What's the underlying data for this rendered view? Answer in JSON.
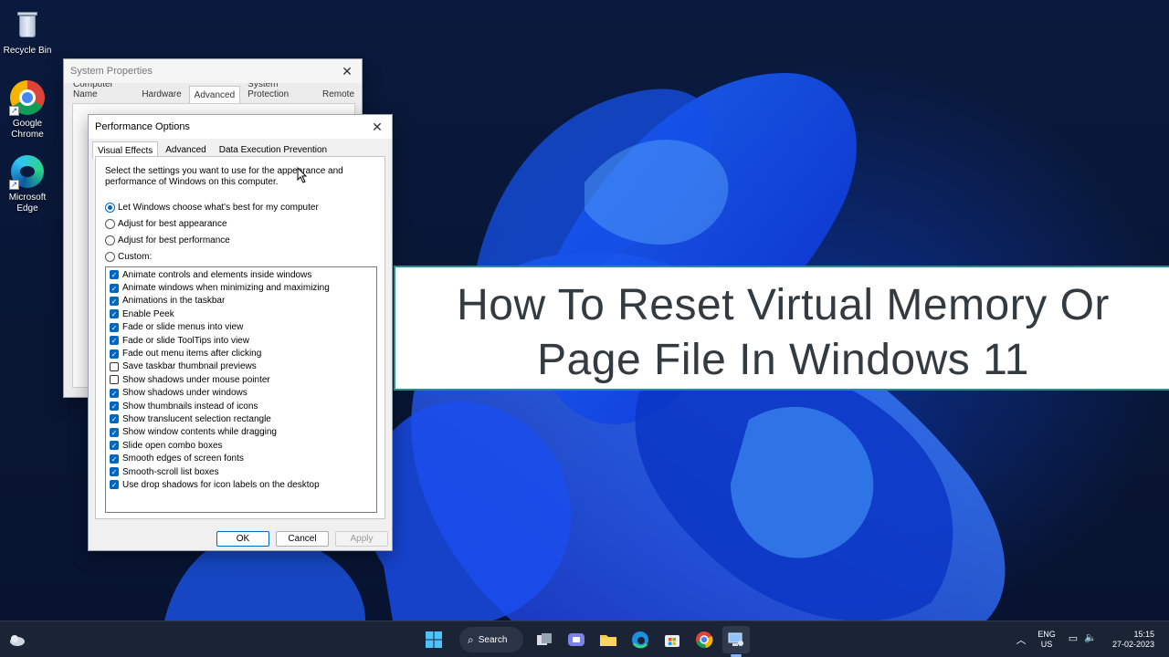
{
  "desktop": {
    "icons": [
      {
        "label": "Recycle Bin"
      },
      {
        "label": "Google\nChrome"
      },
      {
        "label": "Microsoft\nEdge"
      }
    ]
  },
  "system_properties": {
    "title": "System Properties",
    "tabs": [
      "Computer Name",
      "Hardware",
      "Advanced",
      "System Protection",
      "Remote"
    ],
    "active_tab": "Advanced"
  },
  "performance_options": {
    "title": "Performance Options",
    "tabs": [
      "Visual Effects",
      "Advanced",
      "Data Execution Prevention"
    ],
    "active_tab": "Visual Effects",
    "description": "Select the settings you want to use for the appearance and performance of Windows on this computer.",
    "options": [
      {
        "label": "Let Windows choose what's best for my computer",
        "selected": true
      },
      {
        "label": "Adjust for best appearance",
        "selected": false
      },
      {
        "label": "Adjust for best performance",
        "selected": false
      },
      {
        "label": "Custom:",
        "selected": false
      }
    ],
    "effects": [
      {
        "label": "Animate controls and elements inside windows",
        "checked": true
      },
      {
        "label": "Animate windows when minimizing and maximizing",
        "checked": true
      },
      {
        "label": "Animations in the taskbar",
        "checked": true
      },
      {
        "label": "Enable Peek",
        "checked": true
      },
      {
        "label": "Fade or slide menus into view",
        "checked": true
      },
      {
        "label": "Fade or slide ToolTips into view",
        "checked": true
      },
      {
        "label": "Fade out menu items after clicking",
        "checked": true
      },
      {
        "label": "Save taskbar thumbnail previews",
        "checked": false
      },
      {
        "label": "Show shadows under mouse pointer",
        "checked": false
      },
      {
        "label": "Show shadows under windows",
        "checked": true
      },
      {
        "label": "Show thumbnails instead of icons",
        "checked": true
      },
      {
        "label": "Show translucent selection rectangle",
        "checked": true
      },
      {
        "label": "Show window contents while dragging",
        "checked": true
      },
      {
        "label": "Slide open combo boxes",
        "checked": true
      },
      {
        "label": "Smooth edges of screen fonts",
        "checked": true
      },
      {
        "label": "Smooth-scroll list boxes",
        "checked": true
      },
      {
        "label": "Use drop shadows for icon labels on the desktop",
        "checked": true
      }
    ],
    "buttons": {
      "ok": "OK",
      "cancel": "Cancel",
      "apply": "Apply"
    }
  },
  "banner": {
    "line1": "How To Reset Virtual Memory Or",
    "line2": "Page File In Windows 11"
  },
  "taskbar": {
    "search_label": "Search",
    "language": "ENG",
    "region": "US",
    "time": "15:15",
    "date": "27-02-2023"
  },
  "colors": {
    "accent": "#0067c0",
    "banner_border": "#2a8f8a",
    "taskbar": "#1b2435"
  }
}
